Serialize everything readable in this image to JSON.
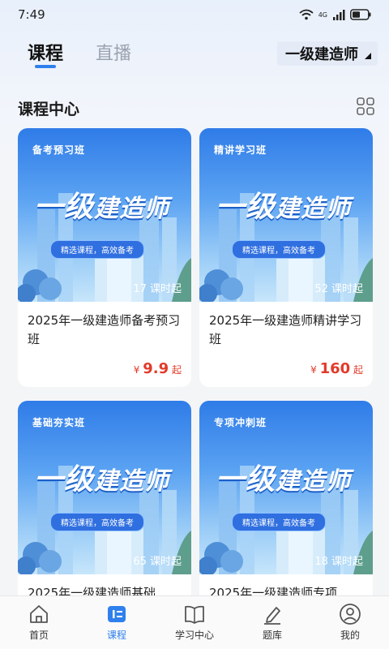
{
  "status": {
    "time": "7:49",
    "network": "4G"
  },
  "top_tabs": [
    {
      "label": "课程",
      "active": true
    },
    {
      "label": "直播",
      "active": false
    }
  ],
  "exam_selector": {
    "label": "一级建造师"
  },
  "section": {
    "title": "课程中心",
    "icon": "grid-view-icon"
  },
  "banner_common": {
    "title_a": "一级",
    "title_b": "建造师",
    "slogan": "精选课程，高效备考"
  },
  "courses": [
    {
      "tag": "备考预习班",
      "lessons": "17 课时起",
      "name": "2025年一级建造师备考预习班",
      "currency": "¥",
      "price": "9.9",
      "suffix": "起"
    },
    {
      "tag": "精讲学习班",
      "lessons": "52 课时起",
      "name": "2025年一级建造师精讲学习班",
      "currency": "¥",
      "price": "160",
      "suffix": "起"
    },
    {
      "tag": "基础夯实班",
      "lessons": "65 课时起",
      "name": "2025年一级建造师基础",
      "currency": "",
      "price": "",
      "suffix": ""
    },
    {
      "tag": "专项冲刺班",
      "lessons": "18 课时起",
      "name": "2025年一级建造师专项",
      "currency": "",
      "price": "",
      "suffix": ""
    }
  ],
  "bottom_nav": [
    {
      "label": "首页",
      "icon": "home-icon",
      "active": false
    },
    {
      "label": "课程",
      "icon": "course-icon",
      "active": true
    },
    {
      "label": "学习中心",
      "icon": "book-icon",
      "active": false
    },
    {
      "label": "题库",
      "icon": "pen-icon",
      "active": false
    },
    {
      "label": "我的",
      "icon": "user-icon",
      "active": false
    }
  ],
  "colors": {
    "accent": "#2f80ed",
    "price": "#e33a2a"
  }
}
